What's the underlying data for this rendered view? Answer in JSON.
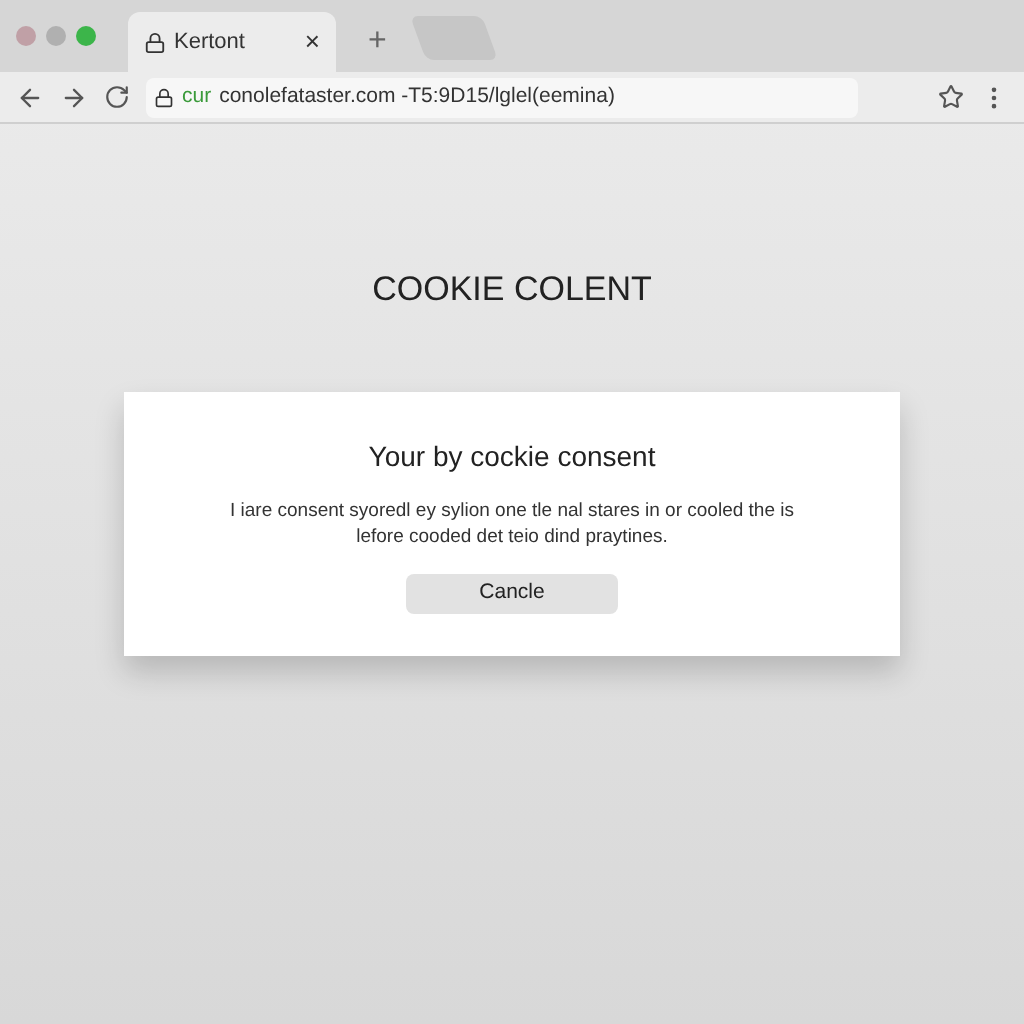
{
  "tabs": [
    {
      "title": "Kertont",
      "close": "×",
      "selected": true
    }
  ],
  "new_tab": "+",
  "address_bar": {
    "scheme": "cur",
    "url": "conolefataster.com -T5:9D15/lglel(eemina)"
  },
  "page": {
    "heading": "COOKIE COLENT",
    "dialog": {
      "title": "Your by cockie consent",
      "body": "I iare consent syoredl ey sylion one tle nal stares in or cooled the is lefore cooded det teio dind praytines.",
      "button": "Cancle"
    }
  }
}
